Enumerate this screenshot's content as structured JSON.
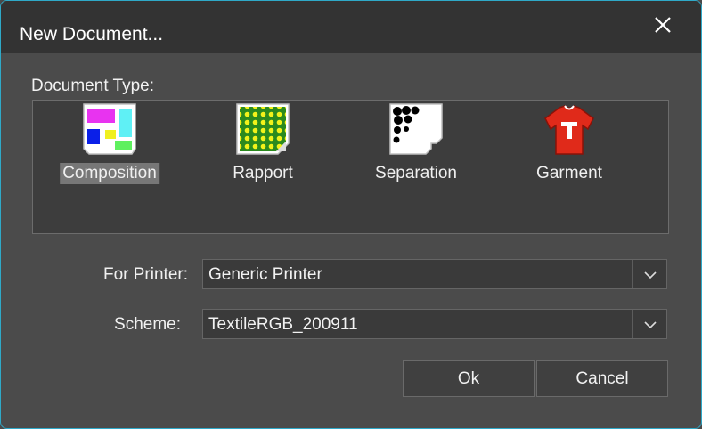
{
  "dialog": {
    "title": "New Document...",
    "close_icon": "close-icon"
  },
  "document_type": {
    "label": "Document Type:",
    "items": [
      {
        "label": "Composition",
        "icon": "composition-icon",
        "selected": true
      },
      {
        "label": "Rapport",
        "icon": "rapport-icon",
        "selected": false
      },
      {
        "label": "Separation",
        "icon": "separation-icon",
        "selected": false
      },
      {
        "label": "Garment",
        "icon": "garment-icon",
        "selected": false
      }
    ]
  },
  "printer": {
    "label": "For Printer:",
    "value": "Generic Printer"
  },
  "scheme": {
    "label": "Scheme:",
    "value": "TextileRGB_200911"
  },
  "buttons": {
    "ok": "Ok",
    "cancel": "Cancel"
  },
  "colors": {
    "titlebar": "#333333",
    "body": "#4b4b4b",
    "border_accent": "#2fa9c8",
    "selection": "#777777"
  }
}
